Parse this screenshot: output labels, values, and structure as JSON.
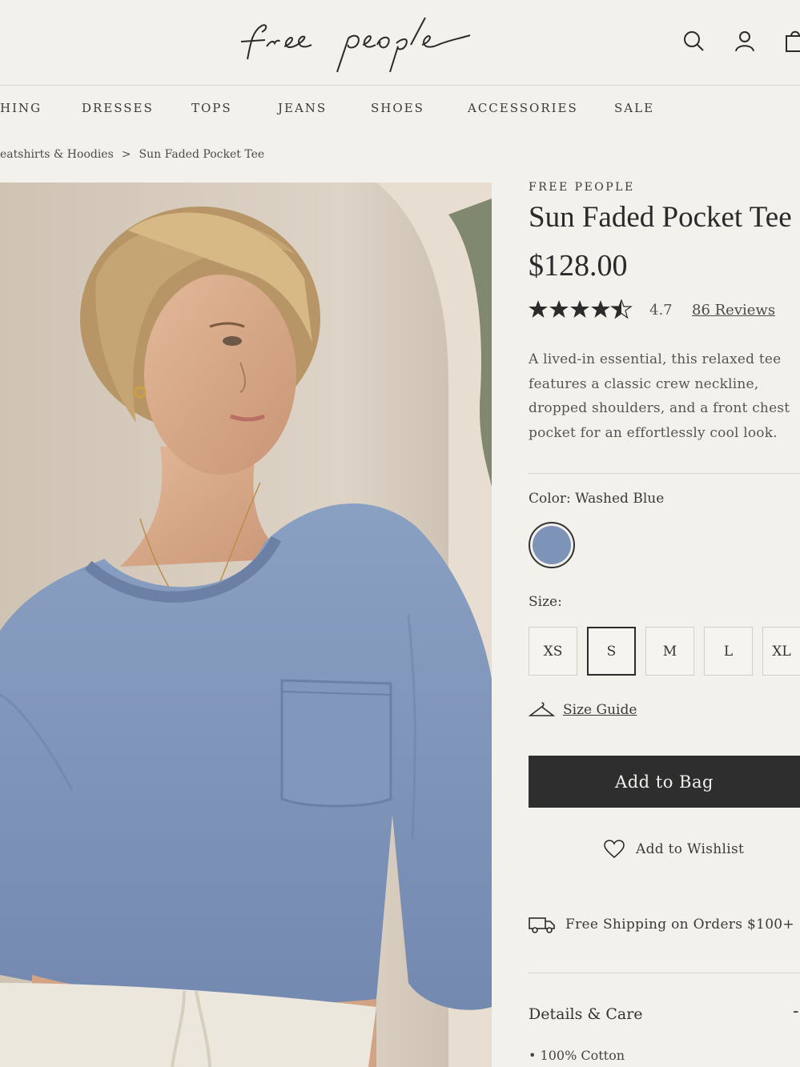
{
  "header": {
    "logo_text": "free people",
    "icons": [
      "search-icon",
      "account-icon",
      "bag-icon"
    ]
  },
  "nav": {
    "items": [
      "HING",
      "DRESSES",
      "TOPS",
      "JEANS",
      "SHOES",
      "ACCESSORIES",
      "SALE"
    ]
  },
  "breadcrumb": {
    "parent": "eatshirts & Hoodies",
    "separator": ">",
    "current": "Sun Faded Pocket Tee"
  },
  "product": {
    "brand": "FREE PEOPLE",
    "title": "Sun Faded Pocket Tee",
    "price": "$128.00",
    "rating": {
      "value": "4.7",
      "stars": 4.5,
      "max": 5,
      "reviews_label": "86 Reviews"
    },
    "description": "A lived-in essential, this relaxed tee features a classic crew neckline, dropped shoulders, and a front chest pocket for an effortlessly cool look.",
    "color": {
      "label": "Color: Washed Blue",
      "swatch": "#7d93b8"
    },
    "size": {
      "label": "Size:",
      "options": [
        "XS",
        "S",
        "M",
        "L",
        "XL"
      ],
      "selected": "S"
    },
    "size_guide_label": "Size Guide",
    "add_to_bag_label": "Add to Bag",
    "wishlist_label": "Add to Wishlist",
    "shipping_label": "Free Shipping on Orders $100+",
    "details": {
      "heading": "Details & Care",
      "toggle": "-",
      "items": [
        "100% Cotton"
      ]
    }
  },
  "colors": {
    "background": "#f3f1ec",
    "text": "#2b2b2b",
    "button_dark": "#2e2e2e",
    "shirt_blue": "#7d93b8"
  }
}
